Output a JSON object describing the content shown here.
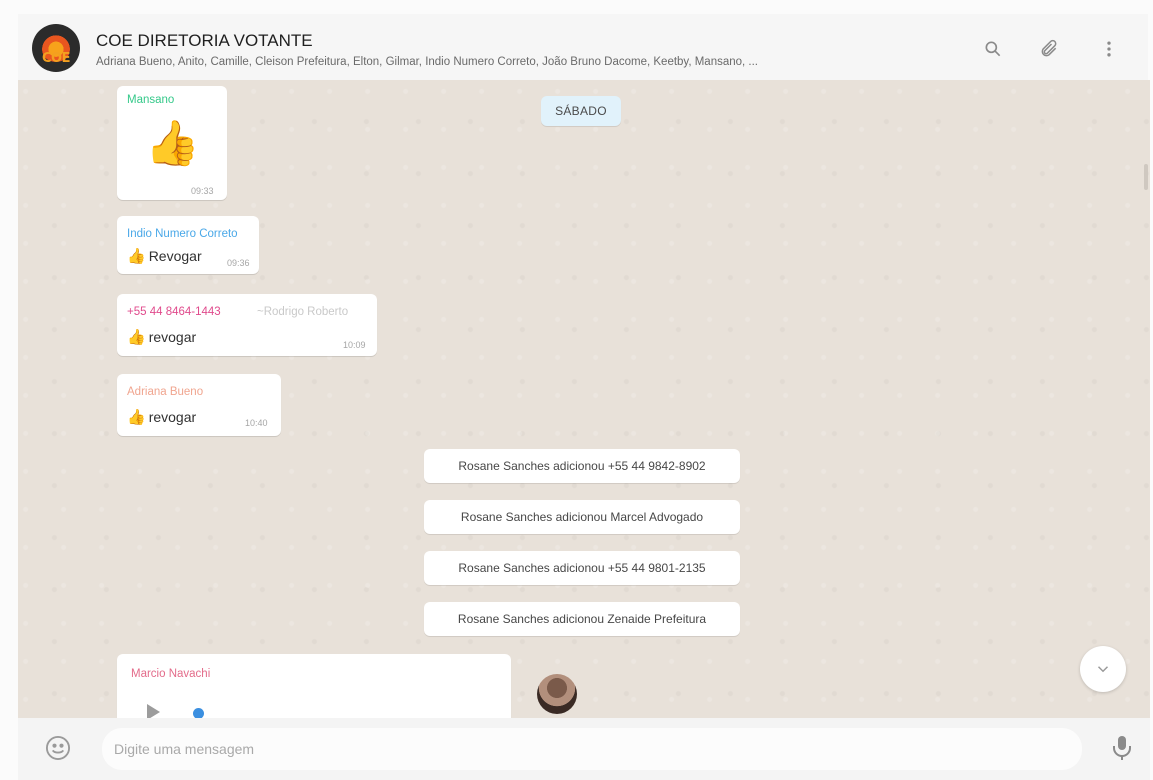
{
  "header": {
    "title": "COE DIRETORIA VOTANTE",
    "members": "Adriana Bueno, Anito, Camille, Cleison Prefeitura, Elton, Gilmar, Indio Numero Correto, João Bruno Dacome, Keetby, Mansano, ...",
    "avatar_text": "COE",
    "icons": [
      "search-icon",
      "paperclip-icon",
      "menu-icon"
    ]
  },
  "chat": {
    "day_label": "SÁBADO",
    "messages": [
      {
        "sender": "Mansano",
        "sender_color": "#35c98a",
        "content": "👍",
        "time": "09:33"
      },
      {
        "sender": "Indio Numero Correto",
        "sender_color": "#4aa8e8",
        "content": "Revogar",
        "time": "09:36"
      },
      {
        "sender": "+55 44 8464-1443",
        "sender_sub": "~Rodrigo Roberto",
        "sender_color": "#e04a8c",
        "content": "revogar",
        "time": "10:09"
      },
      {
        "sender": "Adriana Bueno",
        "sender_color": "#f0a58f",
        "content": "revogar",
        "time": "10:40"
      }
    ],
    "system_messages": [
      "Rosane Sanches adicionou +55 44 9842-8902",
      "Rosane Sanches adicionou Marcel Advogado",
      "Rosane Sanches adicionou +55 44 9801-2135",
      "Rosane Sanches adicionou Zenaide Prefeitura"
    ],
    "voice_message": {
      "sender": "Marcio Navachi",
      "sender_color": "#e36b8a"
    }
  },
  "footer": {
    "placeholder": "Digite uma mensagem"
  },
  "colors": {
    "chat_bg": "#e8e1d9",
    "day_pill_bg": "#e1f2fb",
    "bubble_bg": "#ffffff"
  }
}
